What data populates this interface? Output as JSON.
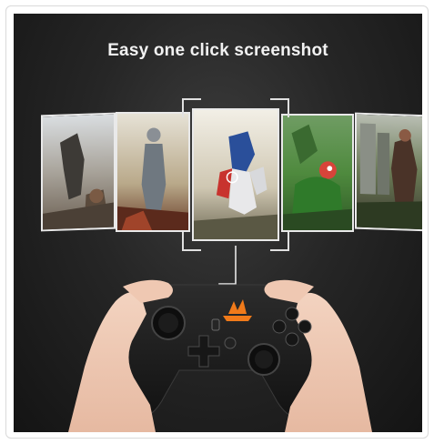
{
  "headline": "Easy one click screenshot",
  "colors": {
    "background": "#1e1e1e",
    "accent_logo": "#f07a1a",
    "controller": "#1f1f1f",
    "card_border": "#e9e9e9"
  },
  "icons": {
    "logo": "flame-logo-icon",
    "screenshot_button": "screenshot-button-icon"
  }
}
